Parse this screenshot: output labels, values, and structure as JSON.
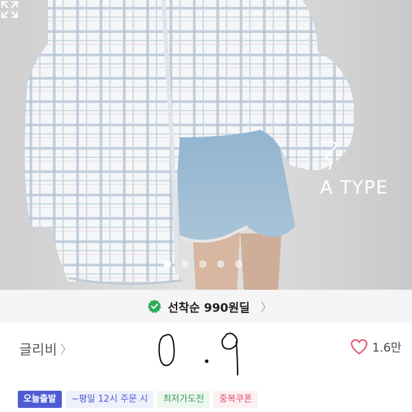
{
  "photo": {
    "type_label": "A TYPE",
    "slides_total": 5,
    "slide_active_index": 0
  },
  "deal": {
    "label": "선착순 990원딜"
  },
  "brand": {
    "name": "글리비",
    "like_count": "1.6만"
  },
  "badges": {
    "today": "오늘출발",
    "time": "~평일 12시 주문 시",
    "lowest": "최저가도전",
    "coupon": "중복쿠폰"
  },
  "colors": {
    "accent_blue": "#4f5bd5",
    "heart_pink": "#e0506f",
    "check_green": "#2eaa5b"
  },
  "icons": [
    "expand-icon",
    "check-badge-icon",
    "chevron-right-icon",
    "heart-icon"
  ]
}
